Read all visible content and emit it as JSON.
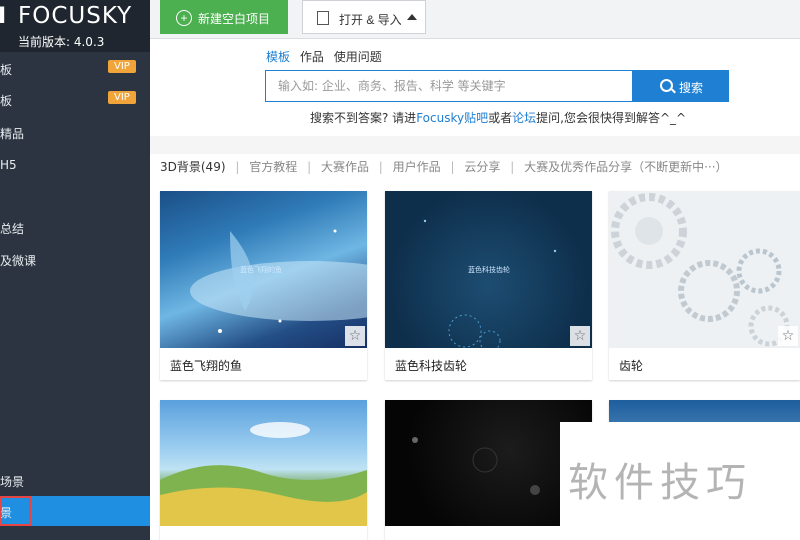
{
  "brand": {
    "name": "FOCUSKY",
    "version": "当前版本: 4.0.3"
  },
  "sidebar": {
    "items": [
      {
        "label": "板",
        "vip": "VIP"
      },
      {
        "label": "板",
        "vip": "VIP"
      },
      {
        "label": "精品"
      },
      {
        "label": "H5"
      },
      {
        "label": "总结"
      },
      {
        "label": "及微课"
      },
      {
        "label": "场景"
      },
      {
        "label": "景"
      }
    ]
  },
  "toolbar": {
    "new_label": "新建空白项目",
    "open_label": "打开 & 导入"
  },
  "search": {
    "tabs": [
      "模板",
      "作品",
      "使用问题"
    ],
    "placeholder": "输入如: 企业、商务、报告、科学 等关键字",
    "button_label": "搜索",
    "hint_pre": "搜索不到答案? 请进",
    "hint_link1": "Focusky贴吧",
    "hint_mid": "或者",
    "hint_link2": "论坛",
    "hint_post": "提问,您会很快得到解答^_^"
  },
  "categories": [
    "3D背景(49)",
    "官方教程",
    "大赛作品",
    "用户作品",
    "云分享",
    "大赛及优秀作品分享（不断更新中···）"
  ],
  "cards": [
    {
      "title": "蓝色飞翔的鱼",
      "inner": "蓝色飞翔的鱼"
    },
    {
      "title": "蓝色科技齿轮",
      "inner": "蓝色科技齿轮"
    },
    {
      "title": "齿轮",
      "inner": ""
    },
    {
      "title": ""
    },
    {
      "title": ""
    },
    {
      "title": ""
    }
  ],
  "watermark": "软件技巧"
}
